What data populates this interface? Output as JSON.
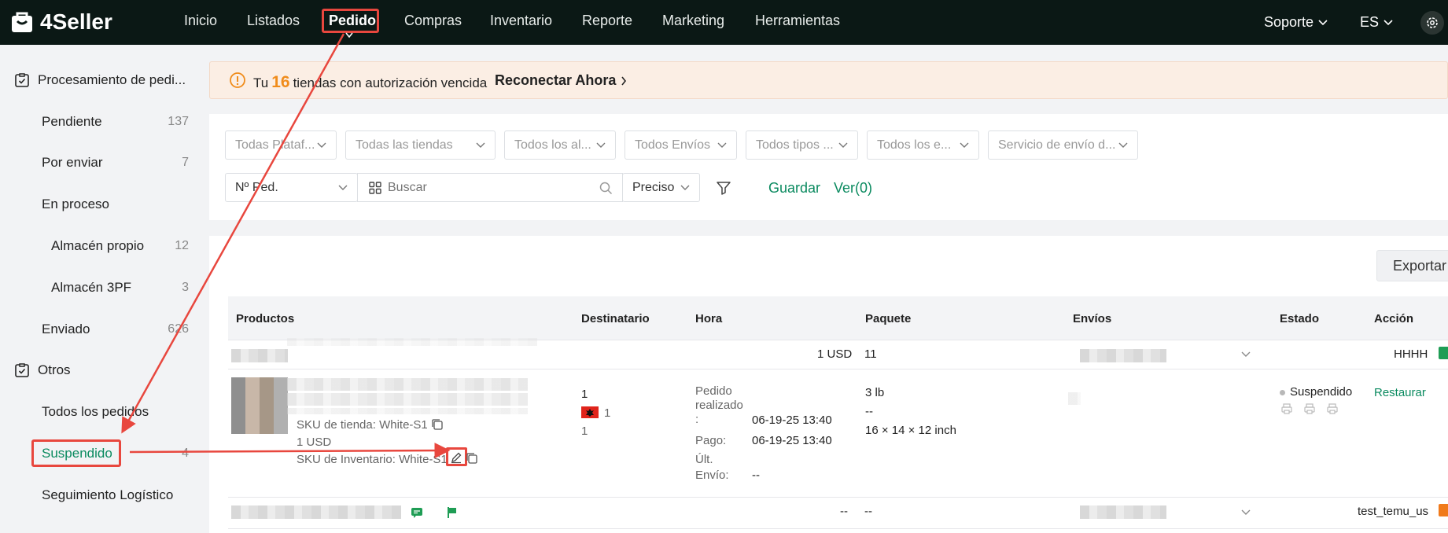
{
  "app": {
    "logo": "4Seller"
  },
  "nav": {
    "items": [
      "Inicio",
      "Listados",
      "Pedido",
      "Compras",
      "Inventario",
      "Reporte",
      "Marketing",
      "Herramientas"
    ],
    "active": "Pedido",
    "support": "Soporte",
    "language": "ES"
  },
  "sidebar": {
    "group1": "Procesamiento de pedi...",
    "items": [
      {
        "label": "Pendiente",
        "count": "137"
      },
      {
        "label": "Por enviar",
        "count": "7"
      },
      {
        "label": "En proceso",
        "count": ""
      },
      {
        "label": "Almacén propio",
        "count": "12"
      },
      {
        "label": "Almacén 3PF",
        "count": "3"
      },
      {
        "label": "Enviado",
        "count": "626"
      }
    ],
    "group2": "Otros",
    "others": [
      {
        "label": "Todos los pedidos",
        "count": ""
      },
      {
        "label": "Suspendido",
        "count": "4"
      },
      {
        "label": "Seguimiento Logístico",
        "count": ""
      }
    ]
  },
  "banner": {
    "prefix": "Tu",
    "count": "16",
    "suffix": "tiendas con autorización vencida",
    "link": "Reconectar Ahora"
  },
  "filters": {
    "platform": "Todas Plataf...",
    "stores": "Todas las tiendas",
    "warehouses": "Todos los al...",
    "shipments": "Todos Envíos",
    "types": "Todos tipos ...",
    "states": "Todos los e...",
    "service": "Servicio de envío d...",
    "field": "Nº Ped.",
    "search_placeholder": "Buscar",
    "match": "Preciso",
    "save": "Guardar",
    "view": "Ver(0)"
  },
  "table": {
    "export": "Exportar",
    "headers": [
      "Productos",
      "Destinatario",
      "Hora",
      "Paquete",
      "Envíos",
      "Estado",
      "Acción"
    ],
    "group_row": {
      "total": "1 USD",
      "package": "11",
      "store": "HHHH"
    },
    "order": {
      "store_sku": "SKU de tienda: White-S1",
      "price": "1 USD",
      "inventory_sku": "SKU de Inventario: White-S1",
      "recipient_qty": "1",
      "flag_qty": "1",
      "recipient_sub": "1",
      "time_ordered_label_1": "Pedido",
      "time_ordered_label_2": "realizado",
      "colon": ":",
      "time_ordered": "06-19-25 13:40",
      "time_paid_label": "Pago:",
      "time_paid": "06-19-25 13:40",
      "time_ship_label_1": "Últ.",
      "time_ship_label_2": "Envío:",
      "time_ship": "--",
      "weight": "3 lb",
      "package_dash": "--",
      "dimensions": "16 × 14 × 12 inch",
      "status": "Suspendido",
      "action": "Restaurar"
    },
    "group_row_2": {
      "total": "--",
      "package": "--",
      "store": "test_temu_us"
    }
  },
  "colors": {
    "accent": "#0a8a5f",
    "nav_bg": "#0b1815",
    "highlight": "#e8473e",
    "banner_num": "#f08c1b"
  }
}
